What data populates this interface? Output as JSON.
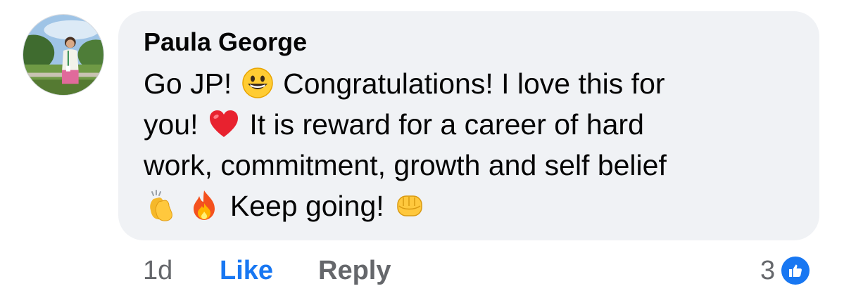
{
  "comment": {
    "author": "Paula George",
    "lines": [
      [
        "Go JP!",
        "grinning-face-emoji",
        "Congratulations! I love this for"
      ],
      [
        "you!",
        "red-heart-emoji",
        "It is reward for a career of hard"
      ],
      [
        "work, commitment, growth and self belief"
      ],
      [
        "clapping-hands-emoji",
        "fire-emoji",
        "Keep going!",
        "oncoming-fist-emoji"
      ]
    ],
    "text": {
      "l1a": "Go JP!",
      "l1b": "Congratulations! I love this for",
      "l2a": "you!",
      "l2b": "It is reward for a career of hard",
      "l3": "work, commitment, growth and self belief",
      "l4": "Keep going!"
    },
    "emojis": [
      "grinning-face",
      "red-heart",
      "clapping-hands",
      "fire",
      "oncoming-fist"
    ]
  },
  "actions": {
    "time": "1d",
    "like_label": "Like",
    "reply_label": "Reply"
  },
  "reactions": {
    "count": "3",
    "icon": "thumbs-up-icon"
  },
  "colors": {
    "bubble_bg": "#f0f2f5",
    "text": "#050505",
    "muted": "#65676b",
    "accent": "#1877f2"
  }
}
